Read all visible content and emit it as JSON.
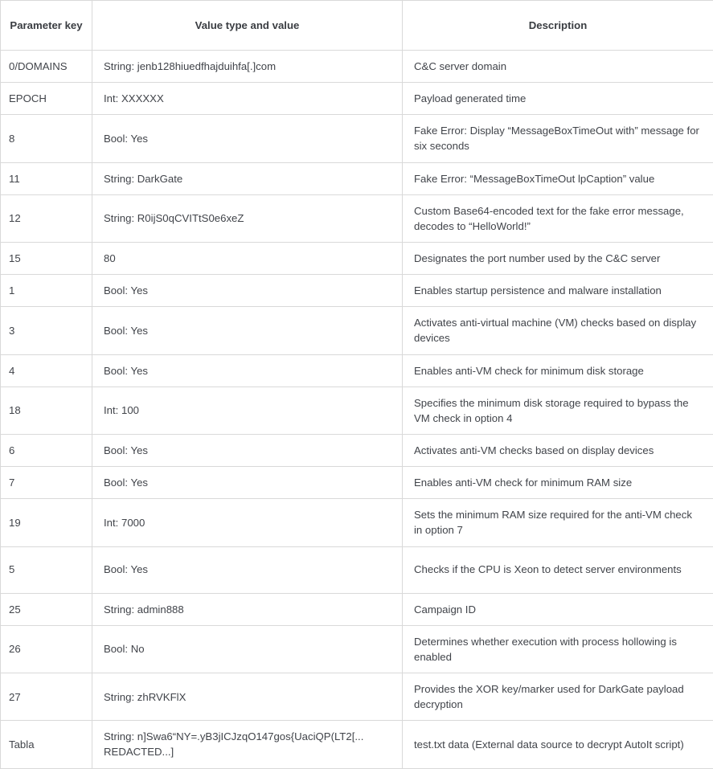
{
  "table": {
    "headers": {
      "key": "Parameter key",
      "value": "Value type and value",
      "description": "Description"
    },
    "rows": [
      {
        "key": "0/DOMAINS",
        "value": "String: jenb128hiuedfhajduihfa[.]com",
        "description": "C&C server domain",
        "lines": 1
      },
      {
        "key": "EPOCH",
        "value": "Int: XXXXXX",
        "description": "Payload generated time",
        "lines": 1
      },
      {
        "key": "8",
        "value": "Bool: Yes",
        "description": "Fake Error: Display “MessageBoxTimeOut with” message for six seconds",
        "lines": 2
      },
      {
        "key": "11",
        "value": "String: DarkGate",
        "description": "Fake Error: “MessageBoxTimeOut lpCaption” value",
        "lines": 1
      },
      {
        "key": "12",
        "value": "String: R0ijS0qCVITtS0e6xeZ",
        "description": "Custom Base64-encoded text for the fake error message, decodes to “HelloWorld!”",
        "lines": 2
      },
      {
        "key": "15",
        "value": "80",
        "description": "Designates the port number used by the C&C server",
        "lines": 1
      },
      {
        "key": "1",
        "value": "Bool: Yes",
        "description": "Enables startup persistence and malware installation",
        "lines": 1
      },
      {
        "key": "3",
        "value": "Bool: Yes",
        "description": "Activates anti-virtual machine (VM) checks based on display devices",
        "lines": 2
      },
      {
        "key": "4",
        "value": "Bool: Yes",
        "description": "Enables anti-VM check for minimum disk storage",
        "lines": 1
      },
      {
        "key": "18",
        "value": "Int: 100",
        "description": "Specifies the minimum disk storage required to bypass the VM check in option 4",
        "lines": 2
      },
      {
        "key": "6",
        "value": "Bool: Yes",
        "description": "Activates anti-VM checks based on display devices",
        "lines": 1
      },
      {
        "key": "7",
        "value": "Bool: Yes",
        "description": "Enables anti-VM check for minimum RAM size",
        "lines": 1
      },
      {
        "key": "19",
        "value": "Int: 7000",
        "description": "Sets the minimum RAM size required for the anti-VM check in option 7",
        "lines": 2
      },
      {
        "key": "5",
        "value": "Bool: Yes",
        "description": "Checks if the CPU is Xeon to detect server environments",
        "lines": 2
      },
      {
        "key": "25",
        "value": "String: admin888",
        "description": "Campaign ID",
        "lines": 1
      },
      {
        "key": "26",
        "value": "Bool: No",
        "description": "Determines whether execution with process hollowing is enabled",
        "lines": 2
      },
      {
        "key": "27",
        "value": "String: zhRVKFlX",
        "description": "Provides the XOR key/marker used for DarkGate payload decryption",
        "lines": 2
      },
      {
        "key": "Tabla",
        "value": "String: n]Swa6“NY=.yB3jICJzqO147gos{UaciQP(LT2[... REDACTED...]",
        "description": "test.txt data (External data source to decrypt AutoIt script)",
        "lines": 2
      }
    ]
  },
  "colors": {
    "border": "#d9d9d9",
    "text": "#41444a",
    "background": "#ffffff"
  }
}
